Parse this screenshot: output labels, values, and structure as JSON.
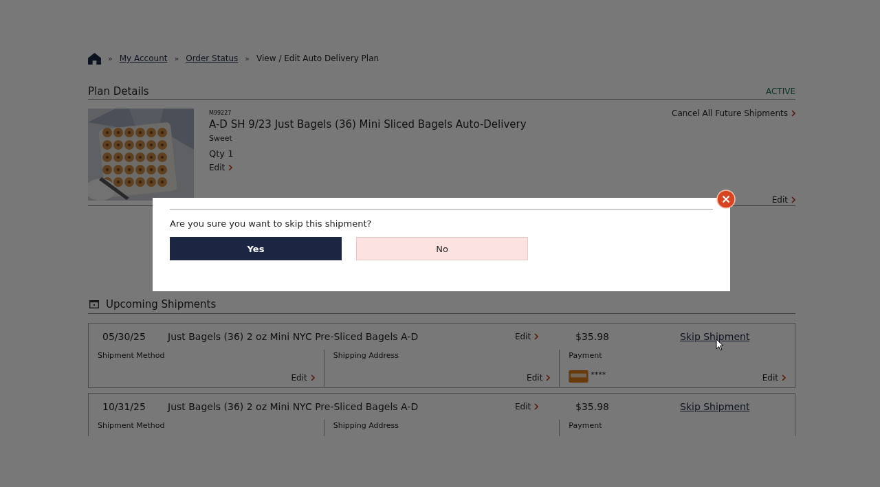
{
  "breadcrumb": [
    {
      "separator": "»",
      "label": "My Account",
      "link": true
    },
    {
      "separator": "»",
      "label": "Order Status",
      "link": true
    },
    {
      "separator": "»",
      "label": "View / Edit Auto Delivery Plan",
      "link": false
    }
  ],
  "plan": {
    "title": "Plan Details",
    "status": "ACTIVE",
    "code": "M99227",
    "name": "A-D SH 9/23 Just Bagels (36) Mini Sliced Bagels Auto-Delivery",
    "variant": "Sweet",
    "quantity": "Qty 1",
    "edit": "Edit",
    "cancel": "Cancel All Future Shipments",
    "second_edit": "Edit"
  },
  "shipments_title": "Upcoming Shipments",
  "shipments": [
    {
      "date": "05/30/25",
      "product": "Just Bagels (36) 2 oz Mini NYC Pre-Sliced Bagels A-D",
      "edit": "Edit",
      "price": "$35.98",
      "skip": "Skip Shipment",
      "method_label": "Shipment Method",
      "method_edit": "Edit",
      "address_label": "Shipping Address",
      "address_edit": "Edit",
      "payment_label": "Payment",
      "card": "****",
      "payment_edit": "Edit"
    },
    {
      "date": "10/31/25",
      "product": "Just Bagels (36) 2 oz Mini NYC Pre-Sliced Bagels A-D",
      "edit": "Edit",
      "price": "$35.98",
      "skip": "Skip Shipment",
      "method_label": "Shipment Method",
      "address_label": "Shipping Address",
      "payment_label": "Payment"
    }
  ],
  "dialog": {
    "question": "Are you sure you want to skip this shipment?",
    "confirm": "Yes",
    "cancel": "No"
  }
}
